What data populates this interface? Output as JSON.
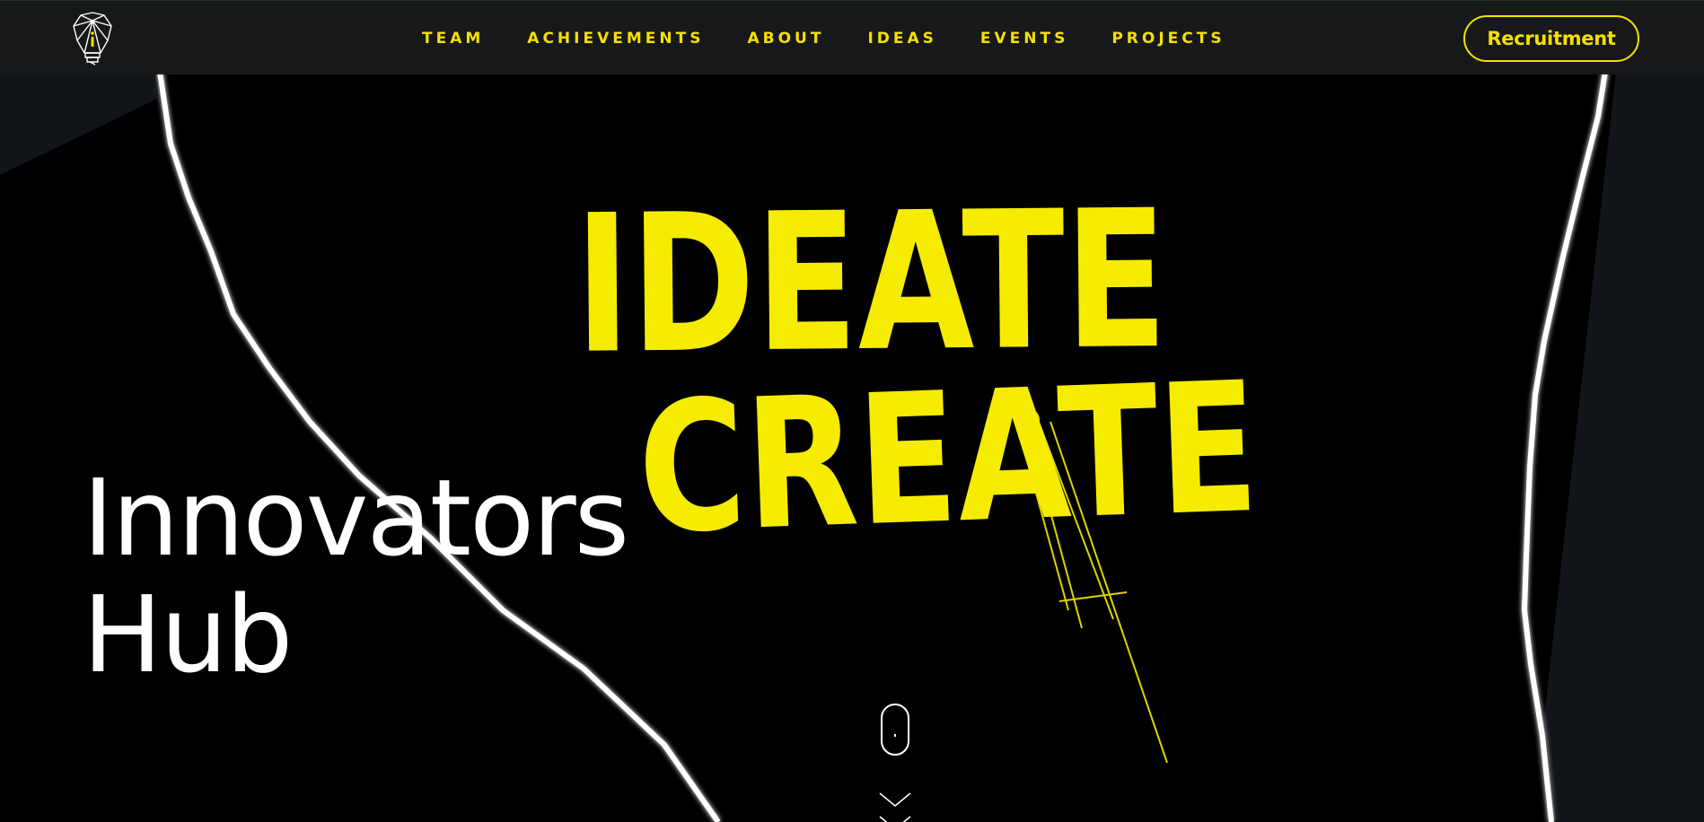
{
  "colors": {
    "accent": "#f5e000",
    "background": "#000000",
    "navbar": "#18191a",
    "text": "#ffffff"
  },
  "navbar": {
    "logo_icon": "lightbulb-i-icon",
    "links": [
      {
        "label": "TEAM"
      },
      {
        "label": "ACHIEVEMENTS"
      },
      {
        "label": "ABOUT"
      },
      {
        "label": "IDEAS"
      },
      {
        "label": "EVENTS"
      },
      {
        "label": "PROJECTS"
      }
    ],
    "cta_label": "Recruitment"
  },
  "hero": {
    "title_line1": "Innovators",
    "title_line2": "Hub",
    "art_line1": "IDEATE",
    "art_line2": "CREATE",
    "scroll_icon": "mouse-scroll-icon",
    "scroll_arrow_icon": "chevron-down-icon"
  }
}
